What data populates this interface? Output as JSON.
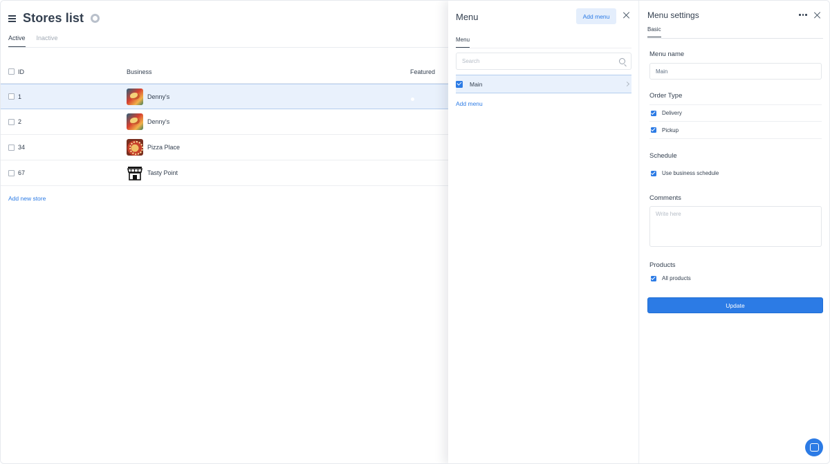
{
  "stores": {
    "title": "Stores list",
    "tabs": [
      {
        "label": "Active",
        "active": true
      },
      {
        "label": "Inactive",
        "active": false
      }
    ],
    "columns": {
      "id": "ID",
      "business": "Business",
      "featured": "Featured"
    },
    "rows": [
      {
        "id": "1",
        "business": "Denny's",
        "thumb": "dennys",
        "featured": false,
        "selected": true
      },
      {
        "id": "2",
        "business": "Denny's",
        "thumb": "dennys",
        "featured": false,
        "selected": false
      },
      {
        "id": "34",
        "business": "Pizza Place",
        "thumb": "pizza",
        "featured": false,
        "selected": false
      },
      {
        "id": "67",
        "business": "Tasty Point",
        "thumb": "store",
        "featured": false,
        "selected": false
      }
    ],
    "add_link": "Add new store"
  },
  "menu_panel": {
    "title": "Menu",
    "add_button": "Add menu",
    "tab": "Menu",
    "search_placeholder": "Search",
    "items": [
      {
        "label": "Main",
        "checked": true
      }
    ],
    "add_link": "Add menu"
  },
  "settings": {
    "title": "Menu settings",
    "tab": "Basic",
    "menu_name_label": "Menu name",
    "menu_name_value": "Main",
    "order_type_label": "Order Type",
    "order_types": [
      {
        "label": "Delivery",
        "checked": true
      },
      {
        "label": "Pickup",
        "checked": true
      }
    ],
    "schedule_label": "Schedule",
    "schedule_option": "Use business schedule",
    "comments_label": "Comments",
    "comments_placeholder": "Write here",
    "products_label": "Products",
    "products_option": "All products",
    "update_button": "Update"
  },
  "colors": {
    "accent": "#2c7be5",
    "selected_row": "#e9f1fc",
    "text": "#344050"
  }
}
